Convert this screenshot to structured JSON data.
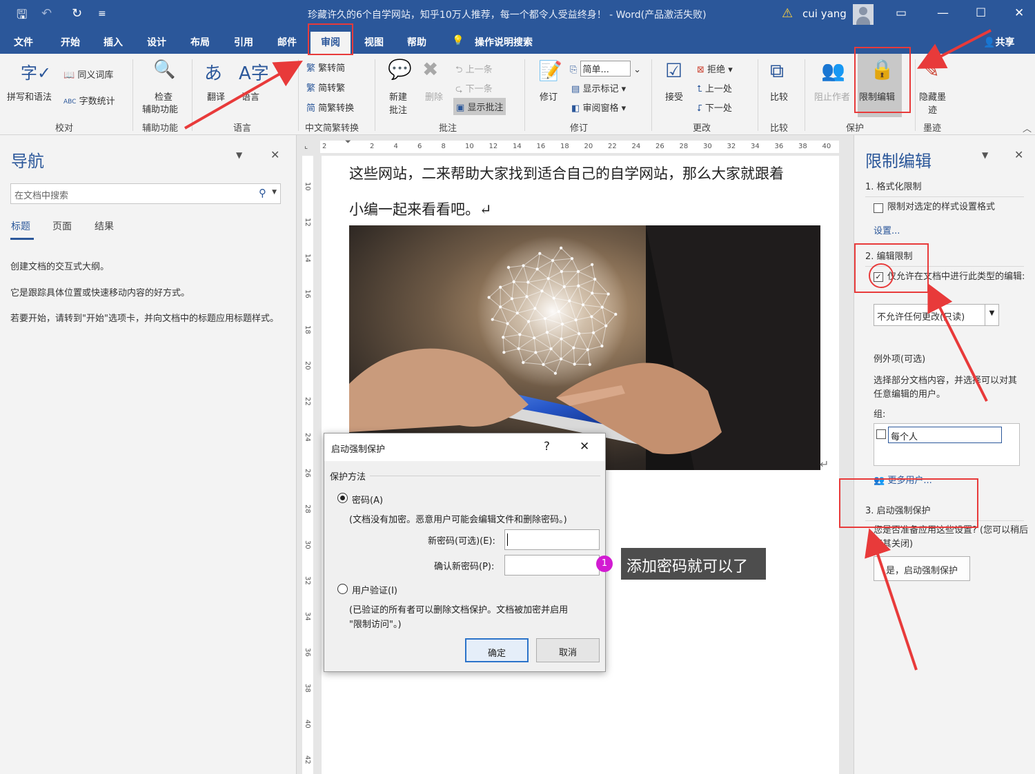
{
  "window": {
    "title": "珍藏许久的6个自学网站，知乎10万人推荐，每一个都令人受益终身！ - Word(产品激活失败)",
    "user": "cui yang",
    "share": "共享"
  },
  "tabs": [
    "文件",
    "开始",
    "插入",
    "设计",
    "布局",
    "引用",
    "邮件",
    "审阅",
    "视图",
    "帮助",
    "操作说明搜索"
  ],
  "ribbon": {
    "proofing": {
      "spelling": "拼写和语法",
      "thesaurus": "同义词库",
      "wordcount": "字数统计",
      "group": "校对"
    },
    "accessibility": {
      "check_line1": "检查",
      "check_line2": "辅助功能",
      "group": "辅助功能"
    },
    "language": {
      "translate": "翻译",
      "language": "语言",
      "group": "语言"
    },
    "chinese": {
      "to_simplified": "繁转简",
      "to_traditional": "简转繁",
      "convert": "简繁转换",
      "group": "中文简繁转换"
    },
    "comments": {
      "new_line1": "新建",
      "new_line2": "批注",
      "delete": "删除",
      "prev": "上一条",
      "next": "下一条",
      "show": "显示批注",
      "group": "批注"
    },
    "tracking": {
      "track": "修订",
      "simple": "简单...",
      "show_markup": "显示标记",
      "review_pane": "审阅窗格",
      "group": "修订"
    },
    "changes": {
      "accept": "接受",
      "reject": "拒绝",
      "prev": "上一处",
      "next": "下一处",
      "group": "更改"
    },
    "compare": {
      "compare": "比较",
      "group": "比较"
    },
    "protect": {
      "block_authors": "阻止作者",
      "restrict": "限制编辑",
      "group": "保护"
    },
    "ink": {
      "hide_line1": "隐藏墨",
      "hide_line2": "迹",
      "group": "墨迹"
    }
  },
  "nav": {
    "title": "导航",
    "search_placeholder": "在文档中搜索",
    "tabs": [
      "标题",
      "页面",
      "结果"
    ],
    "p1": "创建文档的交互式大纲。",
    "p2": "它是跟踪具体位置或快速移动内容的好方式。",
    "p3": "若要开始，请转到\"开始\"选项卡，并向文档中的标题应用标题样式。"
  },
  "ruler": {
    "h": [
      "2",
      "2",
      "4",
      "6",
      "8",
      "10",
      "12",
      "14",
      "16",
      "18",
      "20",
      "22",
      "24",
      "26",
      "28",
      "30",
      "32",
      "34",
      "36",
      "38",
      "40"
    ],
    "v": [
      "10",
      "12",
      "14",
      "16",
      "18",
      "20",
      "22",
      "24",
      "26",
      "28",
      "30",
      "32",
      "34",
      "36",
      "38",
      "40",
      "42"
    ]
  },
  "document": {
    "line1": "这些网站，二来帮助大家找到适合自己的自学网站，那么大家就跟着",
    "line2": "小编一起来看看吧。↵",
    "mark": "↵"
  },
  "restrict": {
    "title": "限制编辑",
    "sec1": "1. 格式化限制",
    "sec1_check": "限制对选定的样式设置格式",
    "settings_link": "设置...",
    "sec2": "2. 编辑限制",
    "sec2_check": "仅允许在文档中进行此类型的编辑:",
    "sec2_select": "不允许任何更改(只读)",
    "exceptions": "例外项(可选)",
    "exceptions_desc": "选择部分文档内容，并选择可以对其任意编辑的用户。",
    "groups_label": "组:",
    "everyone": "每个人",
    "more_users": "更多用户...",
    "sec3": "3. 启动强制保护",
    "sec3_desc": "您是否准备应用这些设置? (您可以稍后将其关闭)",
    "start_button": "是，启动强制保护"
  },
  "dialog": {
    "title": "启动强制保护",
    "help": "?",
    "method": "保护方法",
    "password": "密码(A)",
    "password_desc": "(文档没有加密。恶意用户可能会编辑文件和删除密码。)",
    "new_password": "新密码(可选)(E):",
    "confirm_password": "确认新密码(P):",
    "user_auth": "用户验证(I)",
    "user_auth_desc1": "(已验证的所有者可以删除文档保护。文档被加密并启用",
    "user_auth_desc2": "\"限制访问\"。)",
    "ok": "确定",
    "cancel": "取消"
  },
  "callout": {
    "number": "1",
    "text": "添加密码就可以了"
  },
  "colors": {
    "accent": "#2b579a",
    "annotation": "#e83a3a",
    "badge": "#d21bd2"
  }
}
